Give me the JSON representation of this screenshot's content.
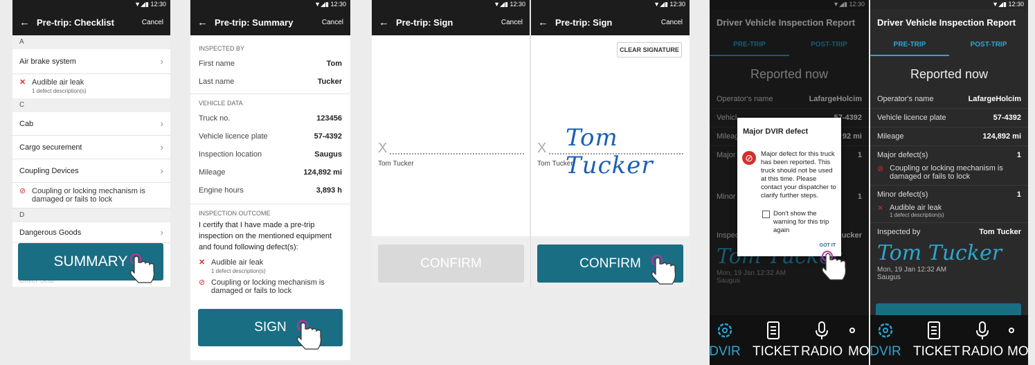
{
  "status": {
    "time": "12:30"
  },
  "checklist": {
    "title": "Pre-trip: Checklist",
    "cancel": "Cancel",
    "sections": {
      "a": "A",
      "c": "C",
      "d": "D"
    },
    "items": {
      "air_brake": "Air brake system",
      "cab": "Cab",
      "cargo": "Cargo securement",
      "coupling": "Coupling Devices",
      "dangerous": "Dangerous Goods",
      "driver_seat": "Driver Seat"
    },
    "defects": {
      "air_leak": "Audible air leak",
      "air_leak_sub": "1 defect description(s)",
      "coupling_defect": "Coupling or locking mechanism is damaged or fails to lock"
    },
    "summary_button": "SUMMARY"
  },
  "summary": {
    "title": "Pre-trip: Summary",
    "cancel": "Cancel",
    "inspected_by_label": "INSPECTED BY",
    "first_name_label": "First name",
    "first_name": "Tom",
    "last_name_label": "Last name",
    "last_name": "Tucker",
    "vehicle_data_label": "VEHICLE DATA",
    "truck_label": "Truck no.",
    "truck": "123456",
    "plate_label": "Vehicle licence plate",
    "plate": "57-4392",
    "location_label": "Inspection location",
    "location": "Saugus",
    "mileage_label": "Mileage",
    "mileage": "124,892 mi",
    "engine_label": "Engine hours",
    "engine": "3,893 h",
    "outcome_label": "INSPECTION OUTCOME",
    "certify": "I certify that I have made a pre-trip inspection on the mentioned equipment and found following defect(s):",
    "defect1": "Audible air leak",
    "defect1_sub": "1 defect description(s)",
    "defect2": "Coupling or locking mechanism is damaged or fails to lock",
    "sign_button": "SIGN"
  },
  "sign": {
    "title": "Pre-trip: Sign",
    "cancel": "Cancel",
    "x": "X",
    "name": "Tom Tucker",
    "signature": "Tom Tucker",
    "clear": "CLEAR SIGNATURE",
    "confirm": "CONFIRM"
  },
  "dvir": {
    "title": "Driver Vehicle Inspection Report",
    "tab_pre": "PRE-TRIP",
    "tab_post": "POST-TRIP",
    "reported": "Reported now",
    "operator_label": "Operator's name",
    "operator": "LafargeHolcim",
    "plate_label": "Vehicle licence plate",
    "plate": "57-4392",
    "mileage_label": "Mileage",
    "mileage": "124,892 mi",
    "major_label": "Major defect(s)",
    "major_count": "1",
    "major_defect": "Coupling or locking mechanism is damaged or fails to lock",
    "minor_label": "Minor defect(s)",
    "minor_count": "1",
    "minor_defect": "Audible air leak",
    "minor_defect_sub": "1 defect description(s)",
    "inspected_label": "Inspected by",
    "inspected": "Tom Tucker",
    "signature": "Tom Tucker",
    "date": "Mon, 19 Jan 12:32 AM",
    "place": "Saugus",
    "nav": {
      "dvir": "DVIR",
      "ticket": "TICKET",
      "radio": "RADIO",
      "more": "MO"
    }
  },
  "dialog": {
    "title": "Major DVIR defect",
    "body": "Major defect for this truck has been reported. This truck should not be used at this time. Please contact your dispatcher to clarify further steps.",
    "checkbox": "Don't show the warning for this trip again",
    "button": "GOT IT",
    "ghost_operator": "Operator's name",
    "ghost_operator_val": "LafargeHolcim",
    "ghost_plate_val": "57-4392",
    "ghost_mileage_val": "92 mi",
    "ghost_vehicle": "Vehicl",
    "ghost_mileage": "Mileag",
    "ghost_major": "Major",
    "ghost_minor": "Minor",
    "ghost_inspected": "Inspec",
    "ghost_inspected_val": "ucker",
    "ghost_one": "1"
  },
  "colors": {
    "teal": "#1a6e84",
    "accent_blue": "#2aa7d3",
    "danger": "#d32f2f"
  }
}
